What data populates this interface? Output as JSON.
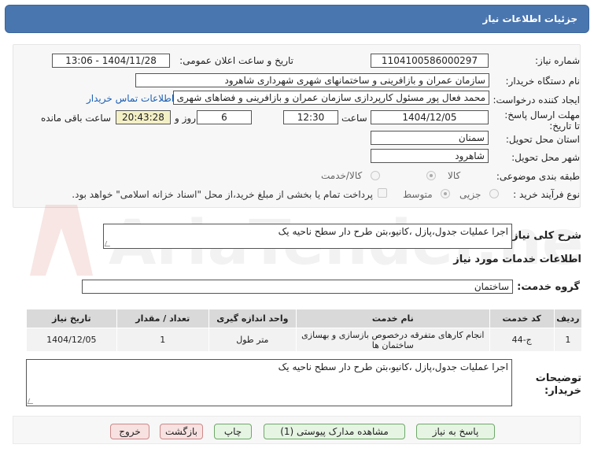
{
  "header": {
    "title": "جزئیات اطلاعات نیاز"
  },
  "form": {
    "need_number_label": "شماره نیاز:",
    "need_number": "1104100586000297",
    "announce_label": "تاریخ و ساعت اعلان عمومی:",
    "announce_value": "1404/11/28 - 13:06",
    "buyer_org_label": "نام دستگاه خریدار:",
    "buyer_org": "سازمان عمران و بازافرینی و ساختمانهای شهری شهرداری شاهرود",
    "creator_label": "ایجاد کننده درخواست:",
    "creator": "محمد فعال پور مسئول کارپردازی سازمان عمران و بازافرینی و فضاهای شهری شا",
    "contact_link": "اطلاعات تماس خریدار",
    "deadline_label": "مهلت ارسال پاسخ: تا تاریخ:",
    "deadline_date": "1404/12/05",
    "time_label": "ساعت",
    "deadline_time": "12:30",
    "days_value": "6",
    "days_label": "روز و",
    "remaining_time": "20:43:28",
    "remaining_label": "ساعت باقی مانده",
    "province_label": "استان محل تحویل:",
    "province": "سمنان",
    "city_label": "شهر محل تحویل:",
    "city": "شاهرود",
    "category_label": "طبقه بندی موضوعی:",
    "category_options": [
      "کالا",
      "کالا/خدمت"
    ],
    "process_label": "نوع فرآیند خرید :",
    "process_options": [
      "جزیی",
      "متوسط"
    ],
    "payment_note": "پرداخت تمام یا بخشی از مبلغ خرید،از محل \"اسناد خزانه اسلامی\" خواهد بود."
  },
  "summary": {
    "label": "شرح کلی نیاز:",
    "text": "اجرا عملیات جدول،پازل ،کانیو،بتن طرح دار سطح ناحیه یک"
  },
  "services": {
    "section_title": "اطلاعات خدمات مورد نیاز",
    "group_label": "گروه خدمت:",
    "group_value": "ساختمان",
    "columns": [
      "ردیف",
      "کد خدمت",
      "نام خدمت",
      "واحد اندازه گیری",
      "تعداد / مقدار",
      "تاریخ نیاز"
    ],
    "rows": [
      {
        "index": "1",
        "code": "ج-44",
        "name": "انجام کارهای متفرقه درخصوص بازسازی و بهسازی ساختمان ها",
        "unit": "متر طول",
        "qty": "1",
        "date": "1404/12/05"
      }
    ]
  },
  "notes": {
    "label": "توضیحات خریدار:",
    "text": "اجرا عملیات جدول،پازل ،کانیو،بتن طرح دار سطح ناحیه یک"
  },
  "buttons": {
    "reply": "پاسخ به نیاز",
    "attachments": "مشاهده مدارک پیوستی (1)",
    "print": "چاپ",
    "back": "بازگشت",
    "exit": "خروج"
  },
  "watermark": {
    "text": "AriaTender.net"
  },
  "colors": {
    "header": "#4a76b0",
    "remaining_bg": "#f4f0c6",
    "link": "#1a5fb4"
  }
}
